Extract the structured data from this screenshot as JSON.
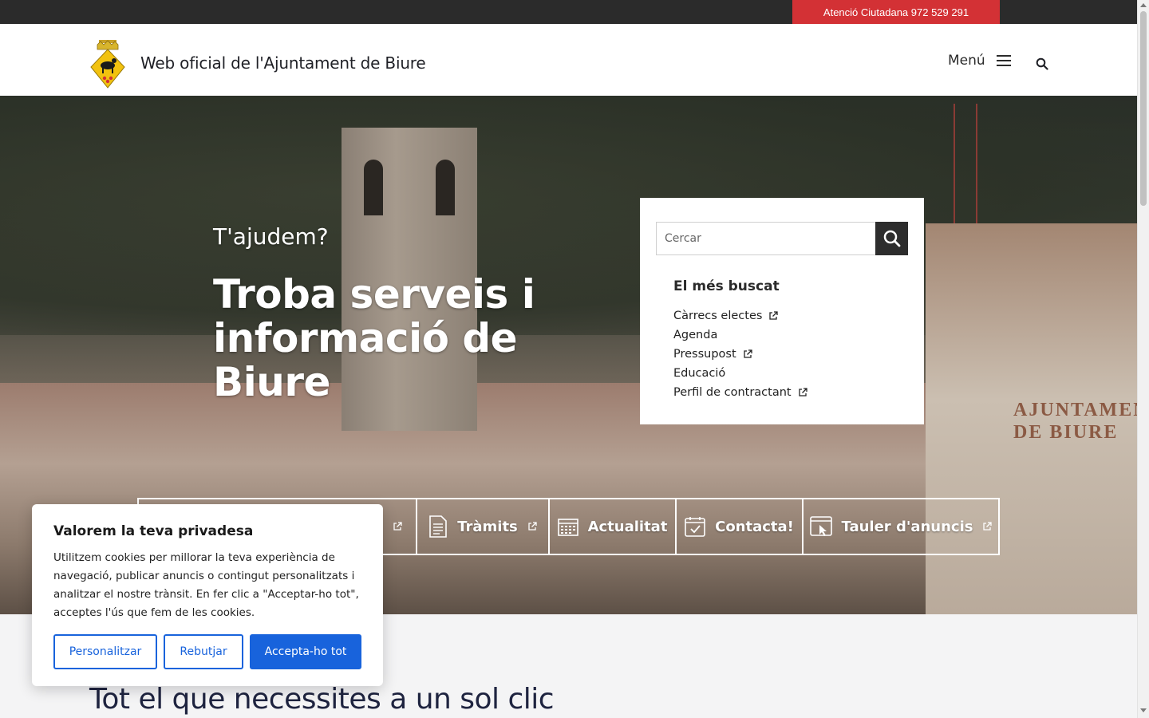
{
  "topbar": {
    "atencio_label": "Atenció Ciutadana 972 529 291"
  },
  "header": {
    "site_title": "Web oficial de l'Ajuntament de Biure",
    "menu_label": "Menú",
    "logo_icon": "coat-of-arms-icon"
  },
  "hero": {
    "small_heading": "T'ajudem?",
    "big_heading": "Troba serveis i informació de Biure",
    "building_sign": "AJUNTAMENT DE BIURE"
  },
  "search": {
    "placeholder": "Cercar",
    "popular_title": "El més buscat",
    "popular_links": [
      {
        "label": "Càrrecs electes",
        "external": true
      },
      {
        "label": "Agenda",
        "external": false
      },
      {
        "label": "Pressupost",
        "external": true
      },
      {
        "label": "Educació",
        "external": false
      },
      {
        "label": "Perfil de contractant",
        "external": true
      }
    ]
  },
  "quicklinks": [
    {
      "label": "Tràmits",
      "icon": "document-icon",
      "external": true
    },
    {
      "label": "Actualitat",
      "icon": "calendar-icon",
      "external": false
    },
    {
      "label": "Contacta!",
      "icon": "calendar-check-icon",
      "external": false
    },
    {
      "label": "Tauler d'anuncis",
      "icon": "browser-click-icon",
      "external": true
    }
  ],
  "main": {
    "section_title": "Tot el que necessites a un sol clic"
  },
  "cookie": {
    "title": "Valorem la teva privadesa",
    "text": "Utilitzem cookies per millorar la teva experiència de navegació, publicar anuncis o contingut personalitzats i analitzar el nostre trànsit. En fer clic a \"Acceptar-ho tot\", acceptes l'ús que fem de les cookies.",
    "customize_label": "Personalitzar",
    "reject_label": "Rebutjar",
    "accept_label": "Accepta-ho tot"
  },
  "colors": {
    "topbar_bg": "#2b2b2b",
    "atencio_bg": "#d33135",
    "cookie_accent": "#1863dc",
    "title_color": "#1f2440"
  }
}
